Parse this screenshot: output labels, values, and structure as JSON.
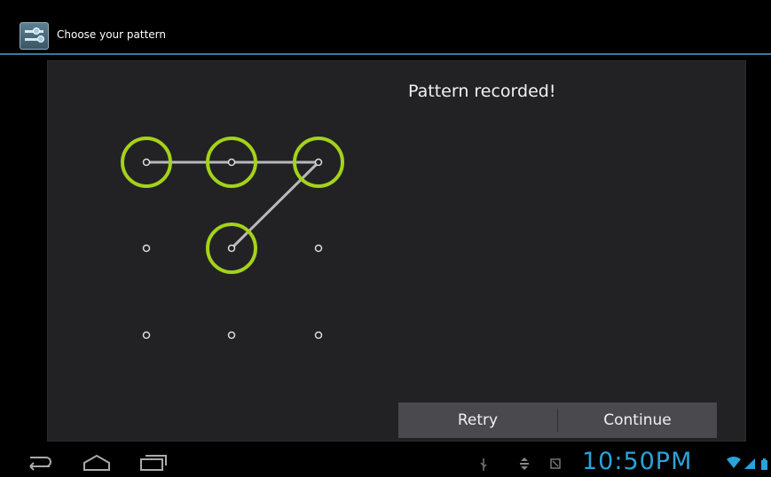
{
  "action_bar": {
    "title": "Choose your pattern",
    "icon": "settings-icon"
  },
  "lock_pattern": {
    "header": "Pattern recorded!",
    "grid": "3x3",
    "selected_sequence": [
      1,
      2,
      3,
      5
    ],
    "accent_color": "#a4d21a"
  },
  "footer": {
    "retry_label": "Retry",
    "continue_label": "Continue"
  },
  "system_bar": {
    "clock": "10:50PM",
    "nav_icons": [
      "back-icon",
      "home-icon",
      "recent-apps-icon"
    ],
    "status_icons": [
      "usb-icon",
      "debug-icon",
      "notification-icon",
      "wifi-icon",
      "signal-icon",
      "battery-icon"
    ]
  }
}
